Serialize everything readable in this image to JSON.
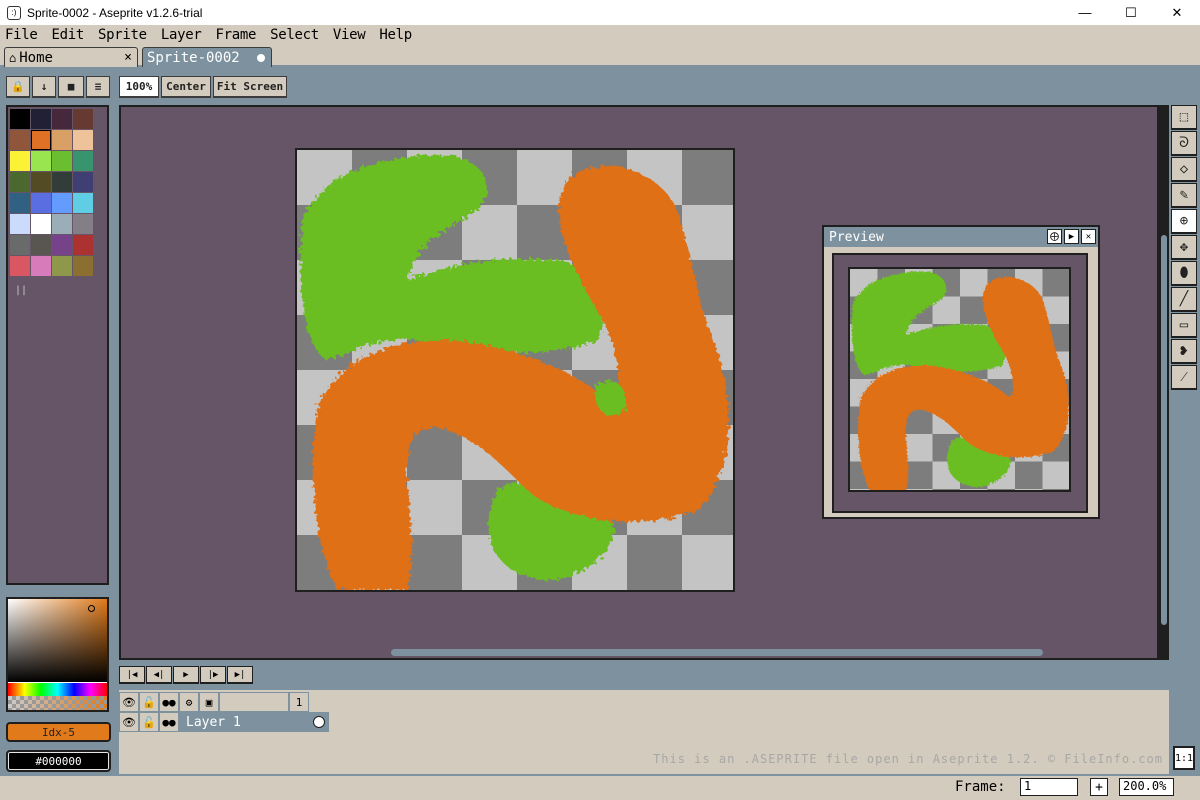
{
  "window": {
    "title": "Sprite-0002 - Aseprite v1.2.6-trial",
    "minimize_icon": "minimize-icon",
    "maximize_icon": "maximize-icon",
    "close_icon": "close-icon"
  },
  "menu": [
    {
      "label": "File"
    },
    {
      "label": "Edit"
    },
    {
      "label": "Sprite"
    },
    {
      "label": "Layer"
    },
    {
      "label": "Frame"
    },
    {
      "label": "Select"
    },
    {
      "label": "View"
    },
    {
      "label": "Help"
    }
  ],
  "tabs": {
    "home": {
      "label": "Home",
      "close": "×"
    },
    "sprite": {
      "label": "Sprite-0002"
    }
  },
  "toolbar": {
    "zoom": "100%",
    "center": "Center",
    "fit_screen": "Fit Screen"
  },
  "palette": {
    "colors": [
      "#000000",
      "#222034",
      "#45283c",
      "#663931",
      "#8f563b",
      "#df7126",
      "#d9a066",
      "#eec39a",
      "#fbf236",
      "#99e550",
      "#6abe30",
      "#37946e",
      "#4b692f",
      "#524b24",
      "#323c39",
      "#3f3f74",
      "#306082",
      "#5b6ee1",
      "#639bff",
      "#5fcde4",
      "#cbdbfc",
      "#ffffff",
      "#9badb7",
      "#847e87",
      "#696a6a",
      "#595652",
      "#76428a",
      "#ac3232",
      "#d95763",
      "#d77bba",
      "#8f974a",
      "#8a6f30"
    ],
    "selected_fg": "Idx-5",
    "selected_bg": "#000000",
    "fg_hex": "#df7126"
  },
  "preview": {
    "title": "Preview"
  },
  "tools": [
    {
      "name": "rectangular-marquee-icon",
      "glyph": "⬚"
    },
    {
      "name": "lasso-icon",
      "glyph": "ᘐ"
    },
    {
      "name": "eraser-icon",
      "glyph": "◇"
    },
    {
      "name": "eyedropper-icon",
      "glyph": "✎"
    },
    {
      "name": "zoom-icon",
      "glyph": "⊕"
    },
    {
      "name": "move-icon",
      "glyph": "✥"
    },
    {
      "name": "paint-bucket-icon",
      "glyph": "⬮"
    },
    {
      "name": "line-icon",
      "glyph": "╱"
    },
    {
      "name": "rectangle-icon",
      "glyph": "▭"
    },
    {
      "name": "contour-icon",
      "glyph": "❥"
    },
    {
      "name": "blur-icon",
      "glyph": "⁄"
    }
  ],
  "timeline": {
    "layer_name": "Layer 1",
    "frame_number": "1",
    "watermark": "This is an .ASEPRITE file open in Aseprite 1.2. © FileInfo.com"
  },
  "status": {
    "frame_label": "Frame:",
    "frame_value": "1",
    "plus": "+",
    "zoom_value": "200.0%",
    "ratio": "1:1"
  }
}
